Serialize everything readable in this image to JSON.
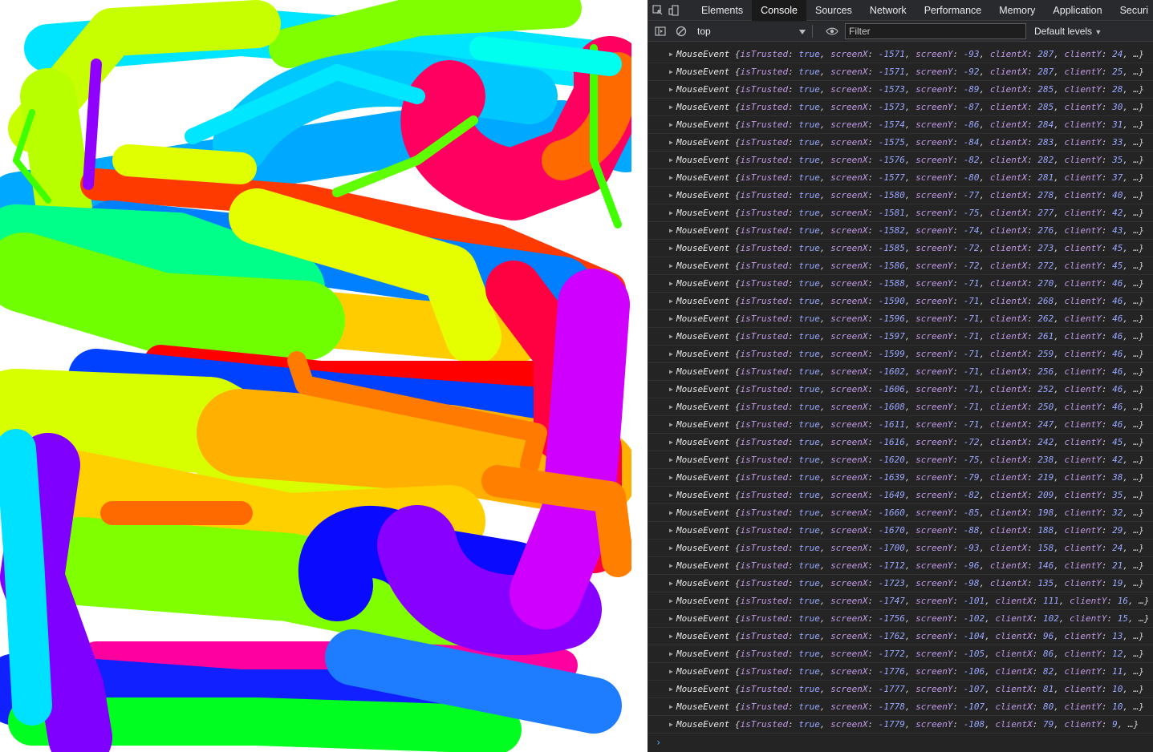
{
  "devtools": {
    "tabs": [
      "Elements",
      "Console",
      "Sources",
      "Network",
      "Performance",
      "Memory",
      "Application",
      "Securi"
    ],
    "active_tab": "Console",
    "context": "top",
    "filter_placeholder": "Filter",
    "levels": "Default levels",
    "icons": [
      "inspect-element-icon",
      "device-toolbar-icon",
      "sidebar-toggle-icon",
      "clear-console-icon",
      "dropdown-arrow-icon",
      "eye-icon",
      "expand-arrow-icon",
      "prompt-caret-icon"
    ]
  },
  "console": {
    "entries": [
      {
        "type": "MouseEvent",
        "isTrusted": "true",
        "screenX": "-1571",
        "screenY": "-93",
        "clientX": "287",
        "clientY": "24"
      },
      {
        "type": "MouseEvent",
        "isTrusted": "true",
        "screenX": "-1571",
        "screenY": "-92",
        "clientX": "287",
        "clientY": "25"
      },
      {
        "type": "MouseEvent",
        "isTrusted": "true",
        "screenX": "-1573",
        "screenY": "-89",
        "clientX": "285",
        "clientY": "28"
      },
      {
        "type": "MouseEvent",
        "isTrusted": "true",
        "screenX": "-1573",
        "screenY": "-87",
        "clientX": "285",
        "clientY": "30"
      },
      {
        "type": "MouseEvent",
        "isTrusted": "true",
        "screenX": "-1574",
        "screenY": "-86",
        "clientX": "284",
        "clientY": "31"
      },
      {
        "type": "MouseEvent",
        "isTrusted": "true",
        "screenX": "-1575",
        "screenY": "-84",
        "clientX": "283",
        "clientY": "33"
      },
      {
        "type": "MouseEvent",
        "isTrusted": "true",
        "screenX": "-1576",
        "screenY": "-82",
        "clientX": "282",
        "clientY": "35"
      },
      {
        "type": "MouseEvent",
        "isTrusted": "true",
        "screenX": "-1577",
        "screenY": "-80",
        "clientX": "281",
        "clientY": "37"
      },
      {
        "type": "MouseEvent",
        "isTrusted": "true",
        "screenX": "-1580",
        "screenY": "-77",
        "clientX": "278",
        "clientY": "40"
      },
      {
        "type": "MouseEvent",
        "isTrusted": "true",
        "screenX": "-1581",
        "screenY": "-75",
        "clientX": "277",
        "clientY": "42"
      },
      {
        "type": "MouseEvent",
        "isTrusted": "true",
        "screenX": "-1582",
        "screenY": "-74",
        "clientX": "276",
        "clientY": "43"
      },
      {
        "type": "MouseEvent",
        "isTrusted": "true",
        "screenX": "-1585",
        "screenY": "-72",
        "clientX": "273",
        "clientY": "45"
      },
      {
        "type": "MouseEvent",
        "isTrusted": "true",
        "screenX": "-1586",
        "screenY": "-72",
        "clientX": "272",
        "clientY": "45"
      },
      {
        "type": "MouseEvent",
        "isTrusted": "true",
        "screenX": "-1588",
        "screenY": "-71",
        "clientX": "270",
        "clientY": "46"
      },
      {
        "type": "MouseEvent",
        "isTrusted": "true",
        "screenX": "-1590",
        "screenY": "-71",
        "clientX": "268",
        "clientY": "46"
      },
      {
        "type": "MouseEvent",
        "isTrusted": "true",
        "screenX": "-1596",
        "screenY": "-71",
        "clientX": "262",
        "clientY": "46"
      },
      {
        "type": "MouseEvent",
        "isTrusted": "true",
        "screenX": "-1597",
        "screenY": "-71",
        "clientX": "261",
        "clientY": "46"
      },
      {
        "type": "MouseEvent",
        "isTrusted": "true",
        "screenX": "-1599",
        "screenY": "-71",
        "clientX": "259",
        "clientY": "46"
      },
      {
        "type": "MouseEvent",
        "isTrusted": "true",
        "screenX": "-1602",
        "screenY": "-71",
        "clientX": "256",
        "clientY": "46"
      },
      {
        "type": "MouseEvent",
        "isTrusted": "true",
        "screenX": "-1606",
        "screenY": "-71",
        "clientX": "252",
        "clientY": "46"
      },
      {
        "type": "MouseEvent",
        "isTrusted": "true",
        "screenX": "-1608",
        "screenY": "-71",
        "clientX": "250",
        "clientY": "46"
      },
      {
        "type": "MouseEvent",
        "isTrusted": "true",
        "screenX": "-1611",
        "screenY": "-71",
        "clientX": "247",
        "clientY": "46"
      },
      {
        "type": "MouseEvent",
        "isTrusted": "true",
        "screenX": "-1616",
        "screenY": "-72",
        "clientX": "242",
        "clientY": "45"
      },
      {
        "type": "MouseEvent",
        "isTrusted": "true",
        "screenX": "-1620",
        "screenY": "-75",
        "clientX": "238",
        "clientY": "42"
      },
      {
        "type": "MouseEvent",
        "isTrusted": "true",
        "screenX": "-1639",
        "screenY": "-79",
        "clientX": "219",
        "clientY": "38"
      },
      {
        "type": "MouseEvent",
        "isTrusted": "true",
        "screenX": "-1649",
        "screenY": "-82",
        "clientX": "209",
        "clientY": "35"
      },
      {
        "type": "MouseEvent",
        "isTrusted": "true",
        "screenX": "-1660",
        "screenY": "-85",
        "clientX": "198",
        "clientY": "32"
      },
      {
        "type": "MouseEvent",
        "isTrusted": "true",
        "screenX": "-1670",
        "screenY": "-88",
        "clientX": "188",
        "clientY": "29"
      },
      {
        "type": "MouseEvent",
        "isTrusted": "true",
        "screenX": "-1700",
        "screenY": "-93",
        "clientX": "158",
        "clientY": "24"
      },
      {
        "type": "MouseEvent",
        "isTrusted": "true",
        "screenX": "-1712",
        "screenY": "-96",
        "clientX": "146",
        "clientY": "21"
      },
      {
        "type": "MouseEvent",
        "isTrusted": "true",
        "screenX": "-1723",
        "screenY": "-98",
        "clientX": "135",
        "clientY": "19"
      },
      {
        "type": "MouseEvent",
        "isTrusted": "true",
        "screenX": "-1747",
        "screenY": "-101",
        "clientX": "111",
        "clientY": "16"
      },
      {
        "type": "MouseEvent",
        "isTrusted": "true",
        "screenX": "-1756",
        "screenY": "-102",
        "clientX": "102",
        "clientY": "15"
      },
      {
        "type": "MouseEvent",
        "isTrusted": "true",
        "screenX": "-1762",
        "screenY": "-104",
        "clientX": "96",
        "clientY": "13"
      },
      {
        "type": "MouseEvent",
        "isTrusted": "true",
        "screenX": "-1772",
        "screenY": "-105",
        "clientX": "86",
        "clientY": "12"
      },
      {
        "type": "MouseEvent",
        "isTrusted": "true",
        "screenX": "-1776",
        "screenY": "-106",
        "clientX": "82",
        "clientY": "11"
      },
      {
        "type": "MouseEvent",
        "isTrusted": "true",
        "screenX": "-1777",
        "screenY": "-107",
        "clientX": "81",
        "clientY": "10"
      },
      {
        "type": "MouseEvent",
        "isTrusted": "true",
        "screenX": "-1778",
        "screenY": "-107",
        "clientX": "80",
        "clientY": "10"
      },
      {
        "type": "MouseEvent",
        "isTrusted": "true",
        "screenX": "-1779",
        "screenY": "-108",
        "clientX": "79",
        "clientY": "9"
      }
    ]
  },
  "colors": {
    "devtools_bg": "#242424",
    "toolbar_bg": "#292a2d",
    "keyword_purple": "#c39be8",
    "value_blue": "#9aa7ff"
  }
}
